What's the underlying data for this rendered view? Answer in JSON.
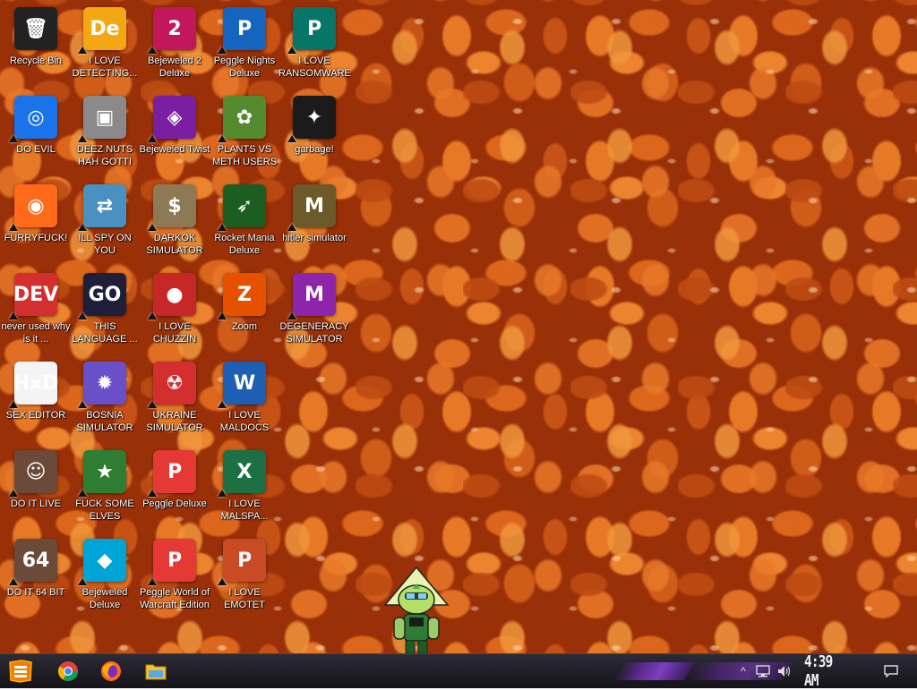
{
  "desktop": {
    "wallpaper": "baked-beans",
    "icons": [
      {
        "label": "Recycle Bin",
        "icon": "recycle-bin-icon",
        "bg": "#222222",
        "glyph": "🗑",
        "col": 0,
        "row": 0
      },
      {
        "label": "DO EVIL",
        "icon": "chrome-icon",
        "bg": "#1a73e8",
        "glyph": "◎",
        "col": 0,
        "row": 1
      },
      {
        "label": "FURRYFUCK!",
        "icon": "firefox-icon",
        "bg": "#ff6a1a",
        "glyph": "◉",
        "col": 0,
        "row": 2
      },
      {
        "label": "never used why is it ...",
        "icon": "devcpp-icon",
        "bg": "#d32f2f",
        "glyph": "DEV",
        "col": 0,
        "row": 3
      },
      {
        "label": "SEX EDITOR",
        "icon": "hxd-icon",
        "bg": "#f4f4f4",
        "glyph": "HxD",
        "col": 0,
        "row": 4
      },
      {
        "label": "DO IT LIVE",
        "icon": "portrait-icon",
        "bg": "#6b4a3a",
        "glyph": "☺",
        "col": 0,
        "row": 5
      },
      {
        "label": "DO IT 64 BIT",
        "icon": "portrait-64-icon",
        "bg": "#6b4a3a",
        "glyph": "64",
        "col": 0,
        "row": 6
      },
      {
        "label": "I LOVE DETECTING...",
        "icon": "de-icon",
        "bg": "#f3a712",
        "glyph": "De",
        "col": 1,
        "row": 0
      },
      {
        "label": "DEEZ NUTS HAH GOTTI",
        "icon": "windows-stack-icon",
        "bg": "#8a8a8a",
        "glyph": "▣",
        "col": 1,
        "row": 1
      },
      {
        "label": "ILL SPY ON YOU",
        "icon": "network-icon",
        "bg": "#4a90c0",
        "glyph": "⇄",
        "col": 1,
        "row": 2
      },
      {
        "label": "THIS LANGUAGE ...",
        "icon": "goland-icon",
        "bg": "#1f1f3a",
        "glyph": "GO",
        "col": 1,
        "row": 3
      },
      {
        "label": "BOSNIA SIMULATOR",
        "icon": "mine-icon",
        "bg": "#6a50c8",
        "glyph": "✹",
        "col": 1,
        "row": 4
      },
      {
        "label": "FUCK SOME ELVES",
        "icon": "santa-icon",
        "bg": "#2e7d32",
        "glyph": "★",
        "col": 1,
        "row": 5
      },
      {
        "label": "Bejeweled Deluxe",
        "icon": "diamond-icon",
        "bg": "#00a5d8",
        "glyph": "◆",
        "col": 1,
        "row": 6
      },
      {
        "label": "Bejeweled 2 Deluxe",
        "icon": "bejeweled2-icon",
        "bg": "#c2185b",
        "glyph": "2",
        "col": 2,
        "row": 0
      },
      {
        "label": "Bejeweled Twist",
        "icon": "gem-twist-icon",
        "bg": "#7b1fa2",
        "glyph": "◈",
        "col": 2,
        "row": 1
      },
      {
        "label": "DARKOK SIMULATOR",
        "icon": "money-bag-icon",
        "bg": "#8d7a55",
        "glyph": "$",
        "col": 2,
        "row": 2
      },
      {
        "label": "I LOVE CHUZZIN",
        "icon": "chuzzle-icon",
        "bg": "#c62828",
        "glyph": "●",
        "col": 2,
        "row": 3
      },
      {
        "label": "UKRAINE SIMULATOR",
        "icon": "radiation-icon",
        "bg": "#d32f2f",
        "glyph": "☢",
        "col": 2,
        "row": 4
      },
      {
        "label": "Peggle Deluxe",
        "icon": "peggle-icon",
        "bg": "#e53935",
        "glyph": "P",
        "col": 2,
        "row": 5
      },
      {
        "label": "Peggle World of Warcraft Edition",
        "icon": "peggle-wow-icon",
        "bg": "#e53935",
        "glyph": "P",
        "col": 2,
        "row": 6
      },
      {
        "label": "Peggle Nights Deluxe",
        "icon": "peggle-nights-icon",
        "bg": "#1565c0",
        "glyph": "P",
        "col": 3,
        "row": 0
      },
      {
        "label": "PLANTS VS METH USERS",
        "icon": "flower-icon",
        "bg": "#558b2f",
        "glyph": "✿",
        "col": 3,
        "row": 1
      },
      {
        "label": "Rocket Mania Deluxe",
        "icon": "rocket-icon",
        "bg": "#1b5e20",
        "glyph": "➶",
        "col": 3,
        "row": 2
      },
      {
        "label": "Zoom",
        "icon": "zuma-icon",
        "bg": "#e65100",
        "glyph": "Z",
        "col": 3,
        "row": 3
      },
      {
        "label": "I LOVE MALDOCS",
        "icon": "word-icon",
        "bg": "#1e5fb3",
        "glyph": "W",
        "col": 3,
        "row": 4
      },
      {
        "label": "I LOVE MALSPA...",
        "icon": "excel-icon",
        "bg": "#1d7044",
        "glyph": "X",
        "col": 3,
        "row": 5
      },
      {
        "label": "I LOVE EMOTET",
        "icon": "powerpoint-icon",
        "bg": "#c84b25",
        "glyph": "P",
        "col": 3,
        "row": 6
      },
      {
        "label": "I LOVE RANSOMWARE",
        "icon": "publisher-icon",
        "bg": "#077568",
        "glyph": "P",
        "col": 4,
        "row": 0
      },
      {
        "label": "garbage!",
        "icon": "steam-like-icon",
        "bg": "#1b1b1b",
        "glyph": "✦",
        "col": 4,
        "row": 1
      },
      {
        "label": "hitler simulator",
        "icon": "coin-icon",
        "bg": "#6d5a2a",
        "glyph": "M",
        "col": 4,
        "row": 2
      },
      {
        "label": "DEGENERACY SIMULATOR",
        "icon": "mediamonkey-icon",
        "bg": "#8e24aa",
        "glyph": "M",
        "col": 4,
        "row": 3
      }
    ]
  },
  "taskbar": {
    "start": {
      "icon": "start-orb-icon"
    },
    "pinned": [
      {
        "name": "chrome",
        "icon": "chrome-icon",
        "color": "#1a73e8"
      },
      {
        "name": "firefox",
        "icon": "firefox-icon",
        "color": "#ff6a1a"
      },
      {
        "name": "explorer",
        "icon": "folder-icon",
        "color": "#f4c430"
      }
    ],
    "tray": {
      "clock": "4:39 AM",
      "expand_glyph": "^"
    }
  },
  "colors": {
    "taskbar_accent": "#7b3fbf",
    "label_text": "#ffffff"
  }
}
